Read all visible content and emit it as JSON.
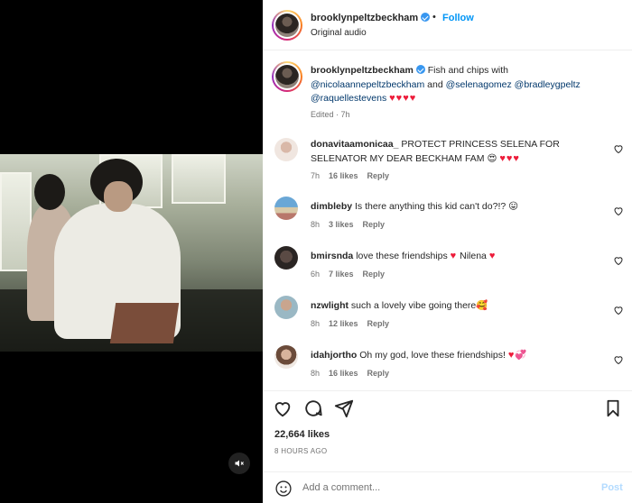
{
  "media": {
    "mute_icon": "speaker-muted-icon"
  },
  "header": {
    "username": "brooklynpeltzbeckham",
    "separator": "•",
    "follow_label": "Follow",
    "audio_label": "Original audio"
  },
  "caption": {
    "username": "brooklynpeltzbeckham",
    "text_1": "Fish and chips with",
    "mention_1": "@nicolaannepeltzbeckham",
    "and": "and",
    "mention_2": "@selenagomez",
    "mention_3": "@bradleygpeltz",
    "mention_4": "@raquellestevens",
    "hearts": "♥♥♥♥",
    "meta": "Edited · 7h"
  },
  "comments": [
    {
      "username": "donavitaamonicaa_",
      "text": "PROTECT PRINCESS SELENA FOR SELENATOR MY DEAR BECKHAM FAM",
      "emoji": "😍",
      "hearts": "♥♥♥",
      "time": "7h",
      "likes": "16 likes",
      "reply": "Reply"
    },
    {
      "username": "dimbleby",
      "text": "Is there anything this kid can't do?!?",
      "emoji": "😛",
      "hearts": "",
      "time": "8h",
      "likes": "3 likes",
      "reply": "Reply"
    },
    {
      "username": "bmirsnda",
      "text": "love these friendships",
      "heart_mid": "♥",
      "text_2": "Nilena",
      "hearts": "♥",
      "time": "6h",
      "likes": "7 likes",
      "reply": "Reply"
    },
    {
      "username": "nzwlight",
      "text": "such a lovely vibe going there",
      "emoji": "🥰",
      "hearts": "",
      "time": "8h",
      "likes": "12 likes",
      "reply": "Reply"
    },
    {
      "username": "idahjortho",
      "text": "Oh my god, love these friendships!",
      "emoji": "",
      "hearts": "♥",
      "hearts_2": "💞",
      "time": "8h",
      "likes": "16 likes",
      "reply": "Reply"
    }
  ],
  "actions": {
    "like_count": "22,664 likes",
    "time_ago": "8 HOURS AGO"
  },
  "composer": {
    "placeholder": "Add a comment...",
    "post_label": "Post"
  },
  "colors": {
    "link_blue": "#0095f6",
    "mention": "#00376b",
    "heart_red": "#ed1c3a",
    "muted_text": "#737373"
  }
}
